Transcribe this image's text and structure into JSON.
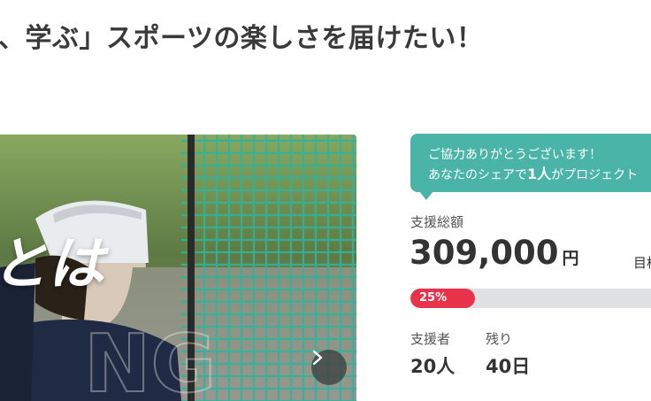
{
  "project": {
    "title": "、学ぶ」スポーツの楽しさを届けたい！"
  },
  "hero": {
    "overlay_text": "とは"
  },
  "share_bubble": {
    "line1": "ご協力ありがとうございます！",
    "line2_prefix": "あなたのシェアで",
    "line2_count": "1人",
    "line2_suffix": "がプロジェクト"
  },
  "funding": {
    "total_label": "支援総額",
    "amount": "309,000",
    "amount_unit": "円",
    "goal_label": "目標",
    "progress_text": "25%",
    "progress_fraction": 0.25,
    "supporters_label": "支援者",
    "supporters_value": "20人",
    "remaining_label": "残り",
    "remaining_value": "40日"
  },
  "colors": {
    "accent_red": "#e8334a",
    "bubble_teal": "#4ab4a8",
    "progress_track": "#dfe1e4"
  },
  "icons": {
    "carousel_next": "chevron-right-icon"
  }
}
